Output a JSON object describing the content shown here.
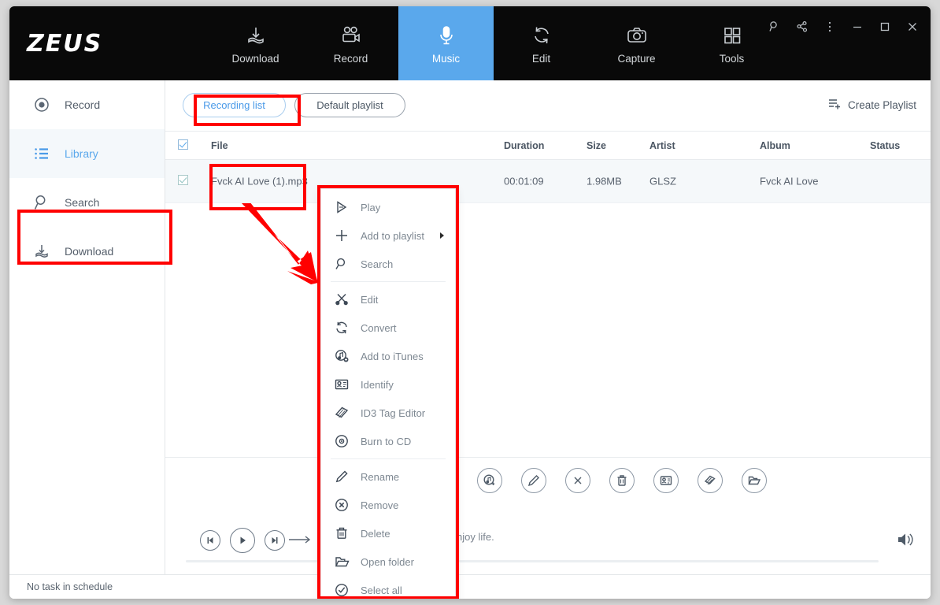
{
  "app": {
    "name": "ZEUS"
  },
  "header": {
    "tabs": [
      {
        "label": "Download",
        "icon": "download-icon",
        "active": false
      },
      {
        "label": "Record",
        "icon": "video-camera-icon",
        "active": false
      },
      {
        "label": "Music",
        "icon": "microphone-icon",
        "active": true
      },
      {
        "label": "Edit",
        "icon": "refresh-icon",
        "active": false
      },
      {
        "label": "Capture",
        "icon": "camera-icon",
        "active": false
      },
      {
        "label": "Tools",
        "icon": "grid-icon",
        "active": false
      }
    ],
    "window_controls": [
      "search-icon",
      "share-icon",
      "more-menu-icon",
      "minimize-icon",
      "maximize-icon",
      "close-icon"
    ],
    "active_tab_color": "#5aa8ec"
  },
  "sidebar": {
    "items": [
      {
        "label": "Record",
        "icon": "record-dot-icon",
        "active": false
      },
      {
        "label": "Library",
        "icon": "list-icon",
        "active": true
      },
      {
        "label": "Search",
        "icon": "magnifier-icon",
        "active": false
      },
      {
        "label": "Download",
        "icon": "download-icon",
        "active": false
      }
    ]
  },
  "tabbar": {
    "tabs": [
      {
        "label": "Recording list",
        "active": true
      },
      {
        "label": "Default playlist",
        "active": false
      }
    ],
    "create_playlist_label": "Create Playlist"
  },
  "table": {
    "columns": [
      "File",
      "Duration",
      "Size",
      "Artist",
      "Album",
      "Status"
    ],
    "header_checked": true,
    "rows": [
      {
        "checked": true,
        "file": "Fvck AI Love (1).mp3",
        "duration": "00:01:09",
        "size": "1.98MB",
        "artist": "GLSZ",
        "album": "Fvck AI Love",
        "status": ""
      }
    ]
  },
  "action_icons": [
    "play-icon",
    "convert-icon",
    "edit-scissors-icon",
    "add-to-itunes-icon",
    "rename-pencil-icon",
    "remove-x-icon",
    "delete-trash-icon",
    "identify-icon",
    "id3-tag-editor-icon",
    "open-folder-icon"
  ],
  "player": {
    "prev_icon": "previous-track-icon",
    "play_icon": "play-icon",
    "next_icon": "next-track-icon",
    "repeat_icon": "repeat-arrow-icon",
    "track_description": "njoy life.",
    "volume_icon": "volume-icon"
  },
  "context_menu": {
    "groups": [
      [
        {
          "label": "Play",
          "icon": "play-icon",
          "submenu": false
        },
        {
          "label": "Add to playlist",
          "icon": "plus-icon",
          "submenu": true
        },
        {
          "label": "Search",
          "icon": "magnifier-icon",
          "submenu": false
        }
      ],
      [
        {
          "label": "Edit",
          "icon": "scissors-icon",
          "submenu": false
        },
        {
          "label": "Convert",
          "icon": "convert-icon",
          "submenu": false
        },
        {
          "label": "Add to iTunes",
          "icon": "add-to-itunes-icon",
          "submenu": false
        },
        {
          "label": "Identify",
          "icon": "identify-icon",
          "submenu": false
        },
        {
          "label": "ID3 Tag Editor",
          "icon": "id3-tag-icon",
          "submenu": false
        },
        {
          "label": "Burn to CD",
          "icon": "burn-cd-icon",
          "submenu": false
        }
      ],
      [
        {
          "label": "Rename",
          "icon": "pencil-icon",
          "submenu": false
        },
        {
          "label": "Remove",
          "icon": "remove-circle-icon",
          "submenu": false
        },
        {
          "label": "Delete",
          "icon": "trash-icon",
          "submenu": false
        },
        {
          "label": "Open folder",
          "icon": "folder-icon",
          "submenu": false
        },
        {
          "label": "Select all",
          "icon": "check-circle-icon",
          "submenu": false
        }
      ]
    ]
  },
  "statusbar": {
    "text": "No task in schedule"
  },
  "annotations": {
    "color": "#ff0000"
  }
}
